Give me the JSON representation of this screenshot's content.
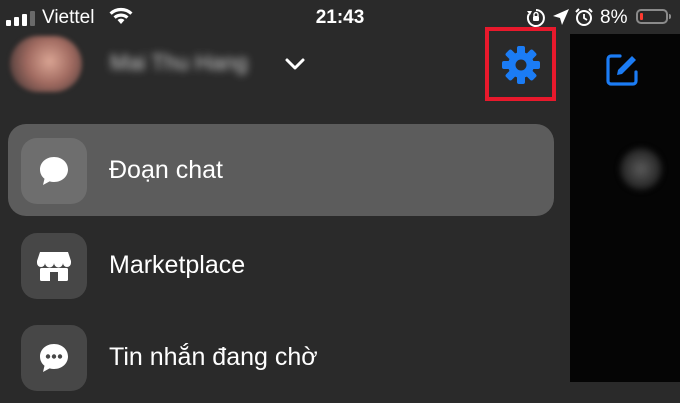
{
  "status_bar": {
    "carrier": "Viettel",
    "time": "21:43",
    "battery_percent": "8%",
    "signal_bars": 3,
    "signal_bars_total": 4,
    "battery_level": 0.08,
    "battery_color": "#ff3b30"
  },
  "header": {
    "username": "Mai Thu Hang",
    "settings_icon": "gear-icon",
    "dropdown_icon": "chevron-down-icon",
    "accent_color": "#1b7cf5",
    "highlight_color": "#e8192c"
  },
  "right_pane": {
    "compose_icon": "compose-icon"
  },
  "menu": {
    "items": [
      {
        "label": "Đoạn chat",
        "icon": "chat-bubble-icon",
        "active": true
      },
      {
        "label": "Marketplace",
        "icon": "store-icon",
        "active": false
      },
      {
        "label": "Tin nhắn đang chờ",
        "icon": "message-pending-icon",
        "active": false
      }
    ]
  }
}
